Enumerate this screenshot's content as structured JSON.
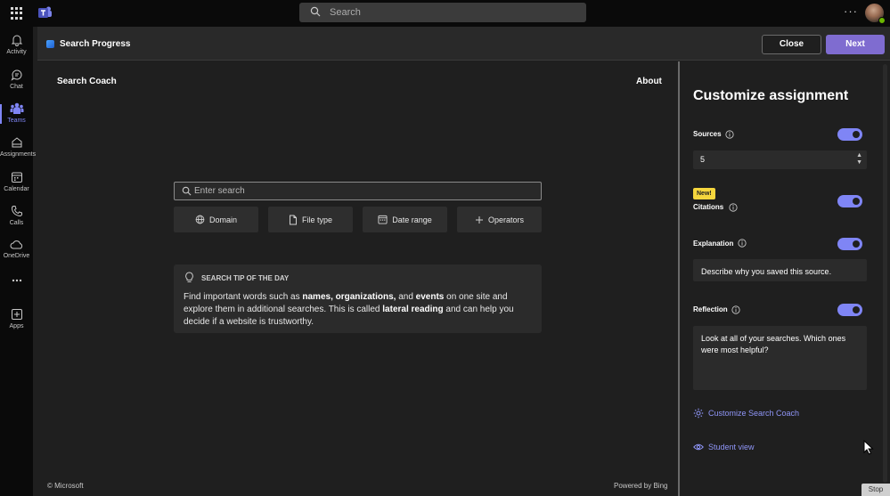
{
  "topbar": {
    "search_placeholder": "Search",
    "more_label": "···"
  },
  "rail": {
    "items": [
      {
        "label": "Activity",
        "icon": "bell-icon"
      },
      {
        "label": "Chat",
        "icon": "chat-icon"
      },
      {
        "label": "Teams",
        "icon": "teams-icon",
        "active": true
      },
      {
        "label": "Assignments",
        "icon": "assignments-icon"
      },
      {
        "label": "Calendar",
        "icon": "calendar-icon"
      },
      {
        "label": "Calls",
        "icon": "phone-icon"
      },
      {
        "label": "OneDrive",
        "icon": "cloud-icon"
      },
      {
        "label": "",
        "icon": "more-icon"
      },
      {
        "label": "Apps",
        "icon": "apps-icon"
      }
    ]
  },
  "header": {
    "title": "Search Progress",
    "close_label": "Close",
    "next_label": "Next"
  },
  "main": {
    "title": "Search Coach",
    "about_label": "About",
    "search_placeholder": "Enter search",
    "filters": [
      {
        "label": "Domain",
        "icon": "globe-icon"
      },
      {
        "label": "File type",
        "icon": "file-icon"
      },
      {
        "label": "Date range",
        "icon": "calendar-icon"
      },
      {
        "label": "Operators",
        "icon": "plus-icon"
      }
    ],
    "tip": {
      "heading": "SEARCH TIP OF THE DAY",
      "runs": [
        {
          "text": "Find important words such as ",
          "bold": false
        },
        {
          "text": "names, organizations,",
          "bold": true
        },
        {
          "text": " and ",
          "bold": false
        },
        {
          "text": "events",
          "bold": true
        },
        {
          "text": " on one site and explore them in additional searches. This is called ",
          "bold": false
        },
        {
          "text": "lateral reading",
          "bold": true
        },
        {
          "text": " and can help you decide if a website is trustworthy.",
          "bold": false
        }
      ]
    },
    "footer_left": "© Microsoft",
    "footer_right": "Powered by Bing"
  },
  "panel": {
    "title": "Customize assignment",
    "sources": {
      "label": "Sources",
      "value": "5",
      "enabled": true
    },
    "citations": {
      "badge": "New!",
      "label": "Citations",
      "enabled": true
    },
    "explanation": {
      "label": "Explanation",
      "enabled": true,
      "text": "Describe why you saved this source."
    },
    "reflection": {
      "label": "Reflection",
      "enabled": true,
      "text": "Look at all of your searches. Which ones were most helpful?"
    },
    "customize_link": "Customize Search Coach",
    "student_view_link": "Student view"
  },
  "overlay": {
    "stop_label": "Stop"
  },
  "colors": {
    "accent": "#7f85f5",
    "next_button": "#7f6cd0",
    "new_badge": "#f5d63d"
  }
}
